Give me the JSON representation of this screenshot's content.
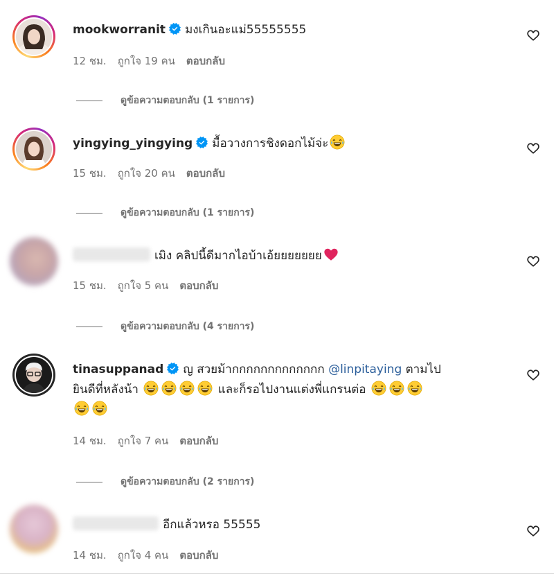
{
  "comments": [
    {
      "username": "mookworranit",
      "verified": true,
      "text": "มงเกินอะแม่55555555",
      "time": "12 ชม.",
      "likes": "ถูกใจ 19 คน",
      "reply": "ตอบกลับ",
      "view_replies": "ดูข้อความตอบกลับ (1 รายการ)"
    },
    {
      "username": "yingying_yingying",
      "verified": true,
      "text": "มื้อวางการชิงดอกไม้จ่ะ",
      "time": "15 ชม.",
      "likes": "ถูกใจ 20 คน",
      "reply": "ตอบกลับ",
      "view_replies": "ดูข้อความตอบกลับ (1 รายการ)"
    },
    {
      "username": "",
      "verified": false,
      "text": "เมิง คลิปนี้ดีมากไอบ้าเอ้ยยยยยยย",
      "time": "15 ชม.",
      "likes": "ถูกใจ 5 คน",
      "reply": "ตอบกลับ",
      "view_replies": "ดูข้อความตอบกลับ (4 รายการ)"
    },
    {
      "username": "tinasuppanad",
      "verified": true,
      "text_part1": "ญ สวยม้ากกกกกกกกกกกกก",
      "mention": "@linpitaying",
      "text_part2": "ตามไป",
      "text_line2": "ยินดีที่หลังน้า",
      "text_line2b": "และก็รอไปงานแต่งพี่แกรนต่อ",
      "time": "14 ชม.",
      "likes": "ถูกใจ 7 คน",
      "reply": "ตอบกลับ",
      "view_replies": "ดูข้อความตอบกลับ (2 รายการ)"
    },
    {
      "username": "",
      "verified": false,
      "text": "อีกแล้วหรอ 55555",
      "time": "14 ชม.",
      "likes": "ถูกใจ 4 คน",
      "reply": "ตอบกลับ"
    }
  ],
  "colors": {
    "text": "#262626",
    "secondary": "#737373",
    "verified": "#0095f6",
    "mention": "#2a5d9a",
    "heart_red": "#e0245e"
  },
  "icons": {
    "verified": "verified-badge-icon",
    "like": "heart-outline-icon",
    "emoji_laugh": "tears-of-joy-emoji",
    "emoji_heart": "red-heart-emoji"
  }
}
